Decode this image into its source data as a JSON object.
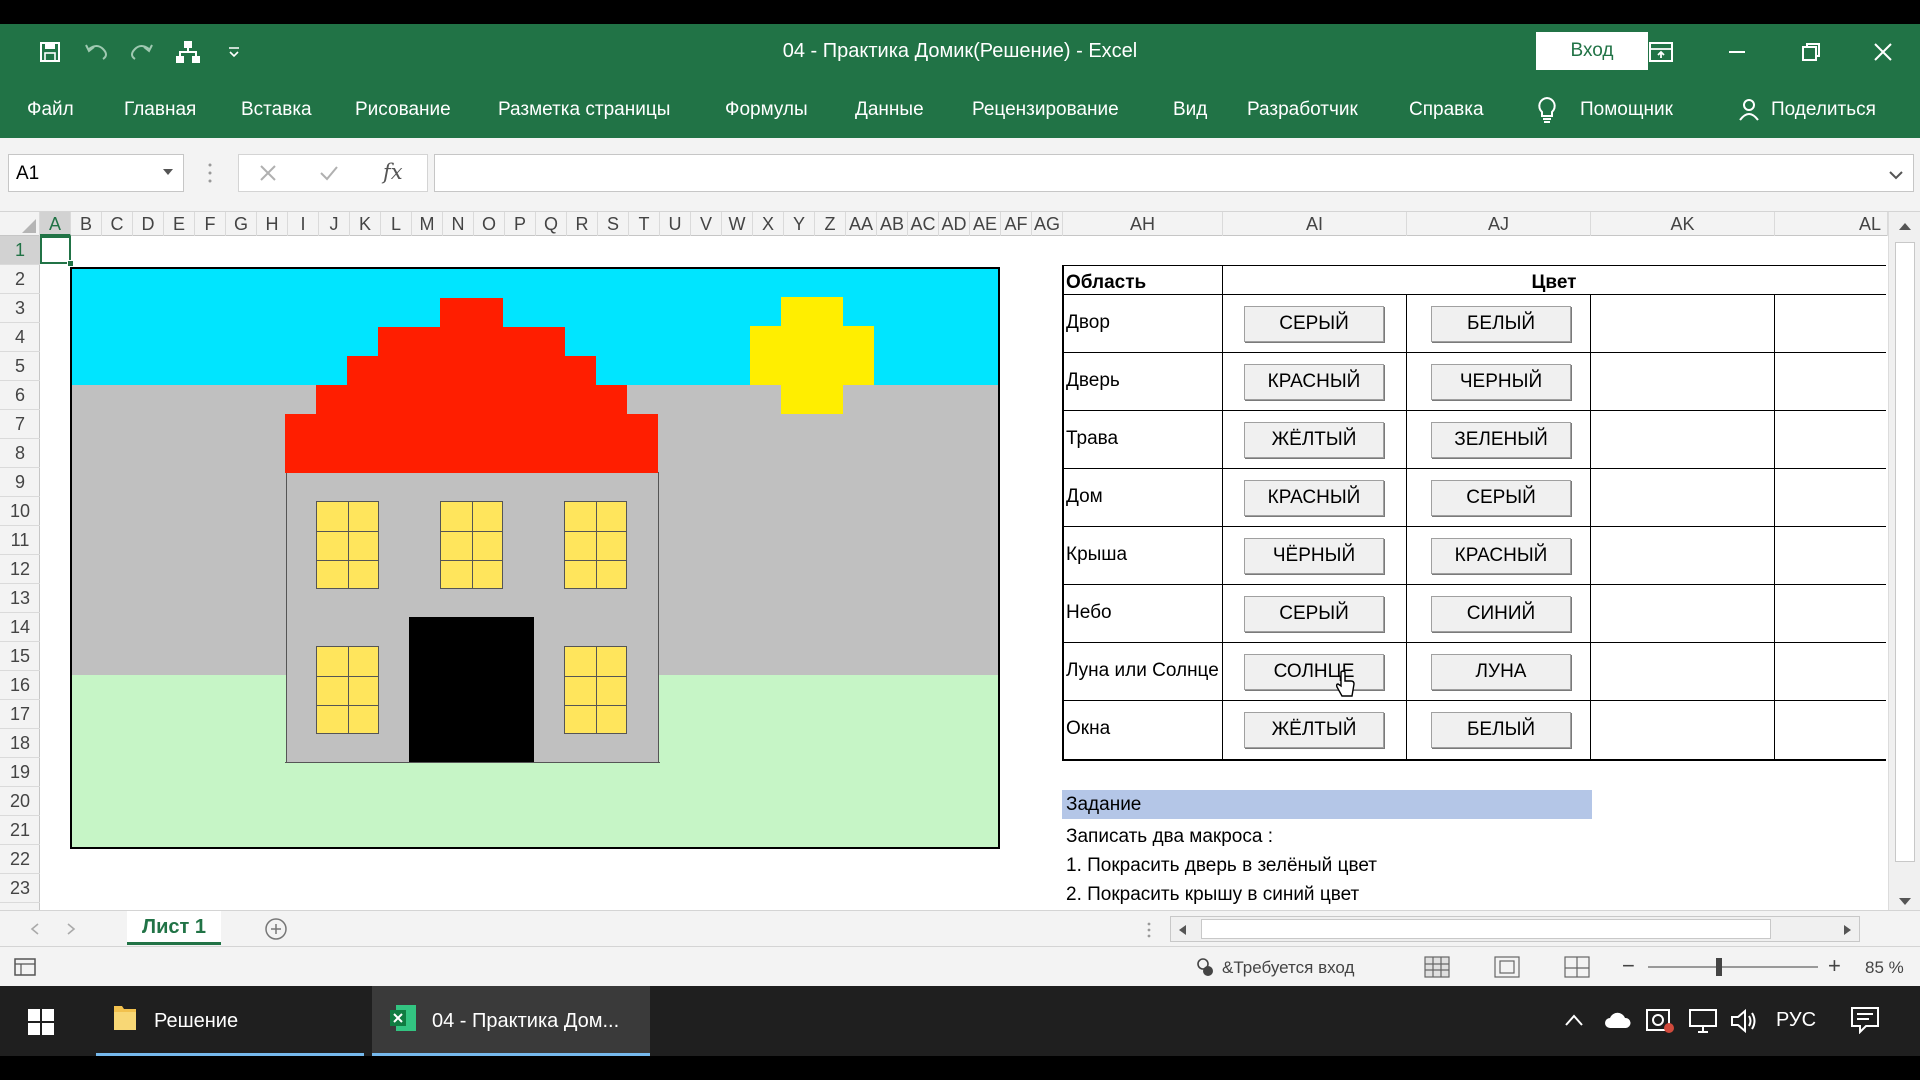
{
  "window": {
    "title": "04 - Практика Домик(Решение)  -  Excel",
    "signin": "Вход"
  },
  "ribbon": {
    "tabs": [
      "Файл",
      "Главная",
      "Вставка",
      "Рисование",
      "Разметка страницы",
      "Формулы",
      "Данные",
      "Рецензирование",
      "Вид",
      "Разработчик",
      "Справка"
    ],
    "assistant": "Помощник",
    "share": "Поделиться"
  },
  "formula_bar": {
    "name_box": "A1",
    "fx": "fx",
    "content": ""
  },
  "columns": [
    "A",
    "B",
    "C",
    "D",
    "E",
    "F",
    "G",
    "H",
    "I",
    "J",
    "K",
    "L",
    "M",
    "N",
    "O",
    "P",
    "Q",
    "R",
    "S",
    "T",
    "U",
    "V",
    "W",
    "X",
    "Y",
    "Z",
    "AA",
    "AB",
    "AC",
    "AD",
    "AE",
    "AF",
    "AG",
    "AH",
    "AI",
    "AJ",
    "AK",
    "AL"
  ],
  "rows": [
    "1",
    "2",
    "3",
    "4",
    "5",
    "6",
    "7",
    "8",
    "9",
    "10",
    "11",
    "12",
    "13",
    "14",
    "15",
    "16",
    "17",
    "18",
    "19",
    "20",
    "21",
    "22",
    "23"
  ],
  "table": {
    "header_area": "Область",
    "header_color": "Цвет",
    "rows": [
      {
        "area": "Двор",
        "b1": "СЕРЫЙ",
        "b2": "БЕЛЫЙ"
      },
      {
        "area": "Дверь",
        "b1": "КРАСНЫЙ",
        "b2": "ЧЕРНЫЙ"
      },
      {
        "area": "Трава",
        "b1": "ЖЁЛТЫЙ",
        "b2": "ЗЕЛЕНЫЙ"
      },
      {
        "area": "Дом",
        "b1": "КРАСНЫЙ",
        "b2": "СЕРЫЙ"
      },
      {
        "area": "Крыша",
        "b1": "ЧЁРНЫЙ",
        "b2": "КРАСНЫЙ"
      },
      {
        "area": "Небо",
        "b1": "СЕРЫЙ",
        "b2": "СИНИЙ"
      },
      {
        "area": "Луна или Солнце",
        "b1": "СОЛНЦЕ",
        "b2": "ЛУНА"
      },
      {
        "area": "Окна",
        "b1": "ЖЁЛТЫЙ",
        "b2": "БЕЛЫЙ"
      }
    ]
  },
  "task": {
    "title": "Задание",
    "lines": [
      "Записать два макроса :",
      "1. Покрасить дверь в зелёный цвет",
      "2. Покрасить крышу в синий цвет"
    ]
  },
  "sheet_tabs": [
    "Лист 1"
  ],
  "status": {
    "signin_required": "&Требуется вход",
    "zoom": "85 %"
  },
  "taskbar": {
    "items": [
      "Решение",
      "04 - Практика Дом..."
    ],
    "lang": "РУС"
  },
  "colors": {
    "excel_green": "#217346",
    "sky": "#00e5ff",
    "yard": "#c0c0c0",
    "grass": "#c6f5c6",
    "roof": "#ff1e00",
    "sun": "#ffee00",
    "window": "#ffe55c",
    "door": "#000000",
    "task_header": "#b4c6e7"
  }
}
